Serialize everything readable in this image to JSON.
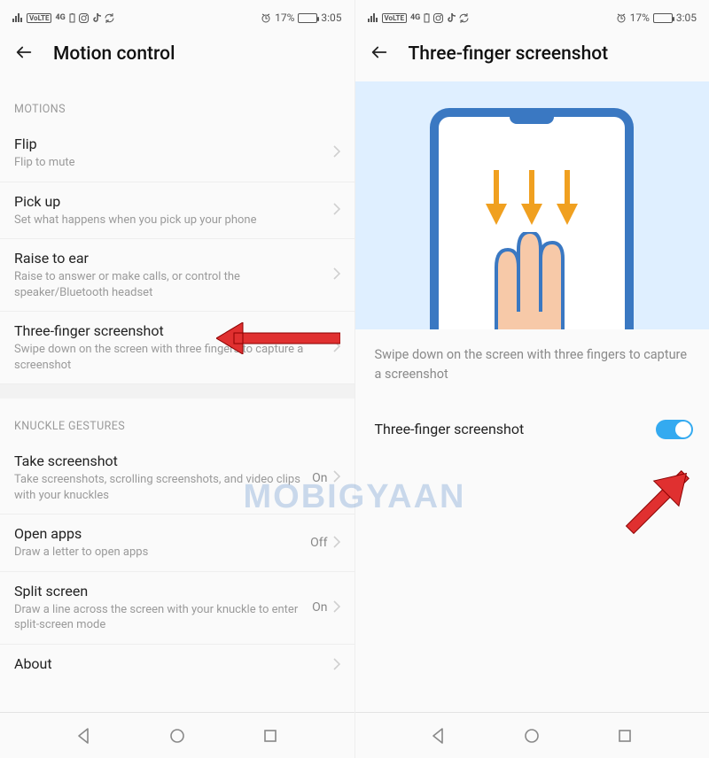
{
  "status": {
    "volte": "VoLTE",
    "net": "4G",
    "battery_pct": "17%",
    "time": "3:05"
  },
  "left": {
    "title": "Motion control",
    "section1": "MOTIONS",
    "rows1": [
      {
        "title": "Flip",
        "sub": "Flip to mute"
      },
      {
        "title": "Pick up",
        "sub": "Set what happens when you pick up your phone"
      },
      {
        "title": "Raise to ear",
        "sub": "Raise to answer or make calls, or control the speaker/Bluetooth headset"
      },
      {
        "title": "Three-finger screenshot",
        "sub": "Swipe down on the screen with three fingers to capture a screenshot"
      }
    ],
    "section2": "KNUCKLE GESTURES",
    "rows2": [
      {
        "title": "Take screenshot",
        "sub": "Take screenshots, scrolling screenshots, and video clips with your knuckles",
        "value": "On"
      },
      {
        "title": "Open apps",
        "sub": "Draw a letter to open apps",
        "value": "Off"
      },
      {
        "title": "Split screen",
        "sub": "Draw a line across the screen with your knuckle to enter split-screen mode",
        "value": "On"
      },
      {
        "title": "About",
        "sub": ""
      }
    ]
  },
  "right": {
    "title": "Three-finger screenshot",
    "desc": "Swipe down on the screen with three fingers to capture a screenshot",
    "toggle_label": "Three-finger screenshot"
  },
  "watermark": "MOBIGYAAN"
}
